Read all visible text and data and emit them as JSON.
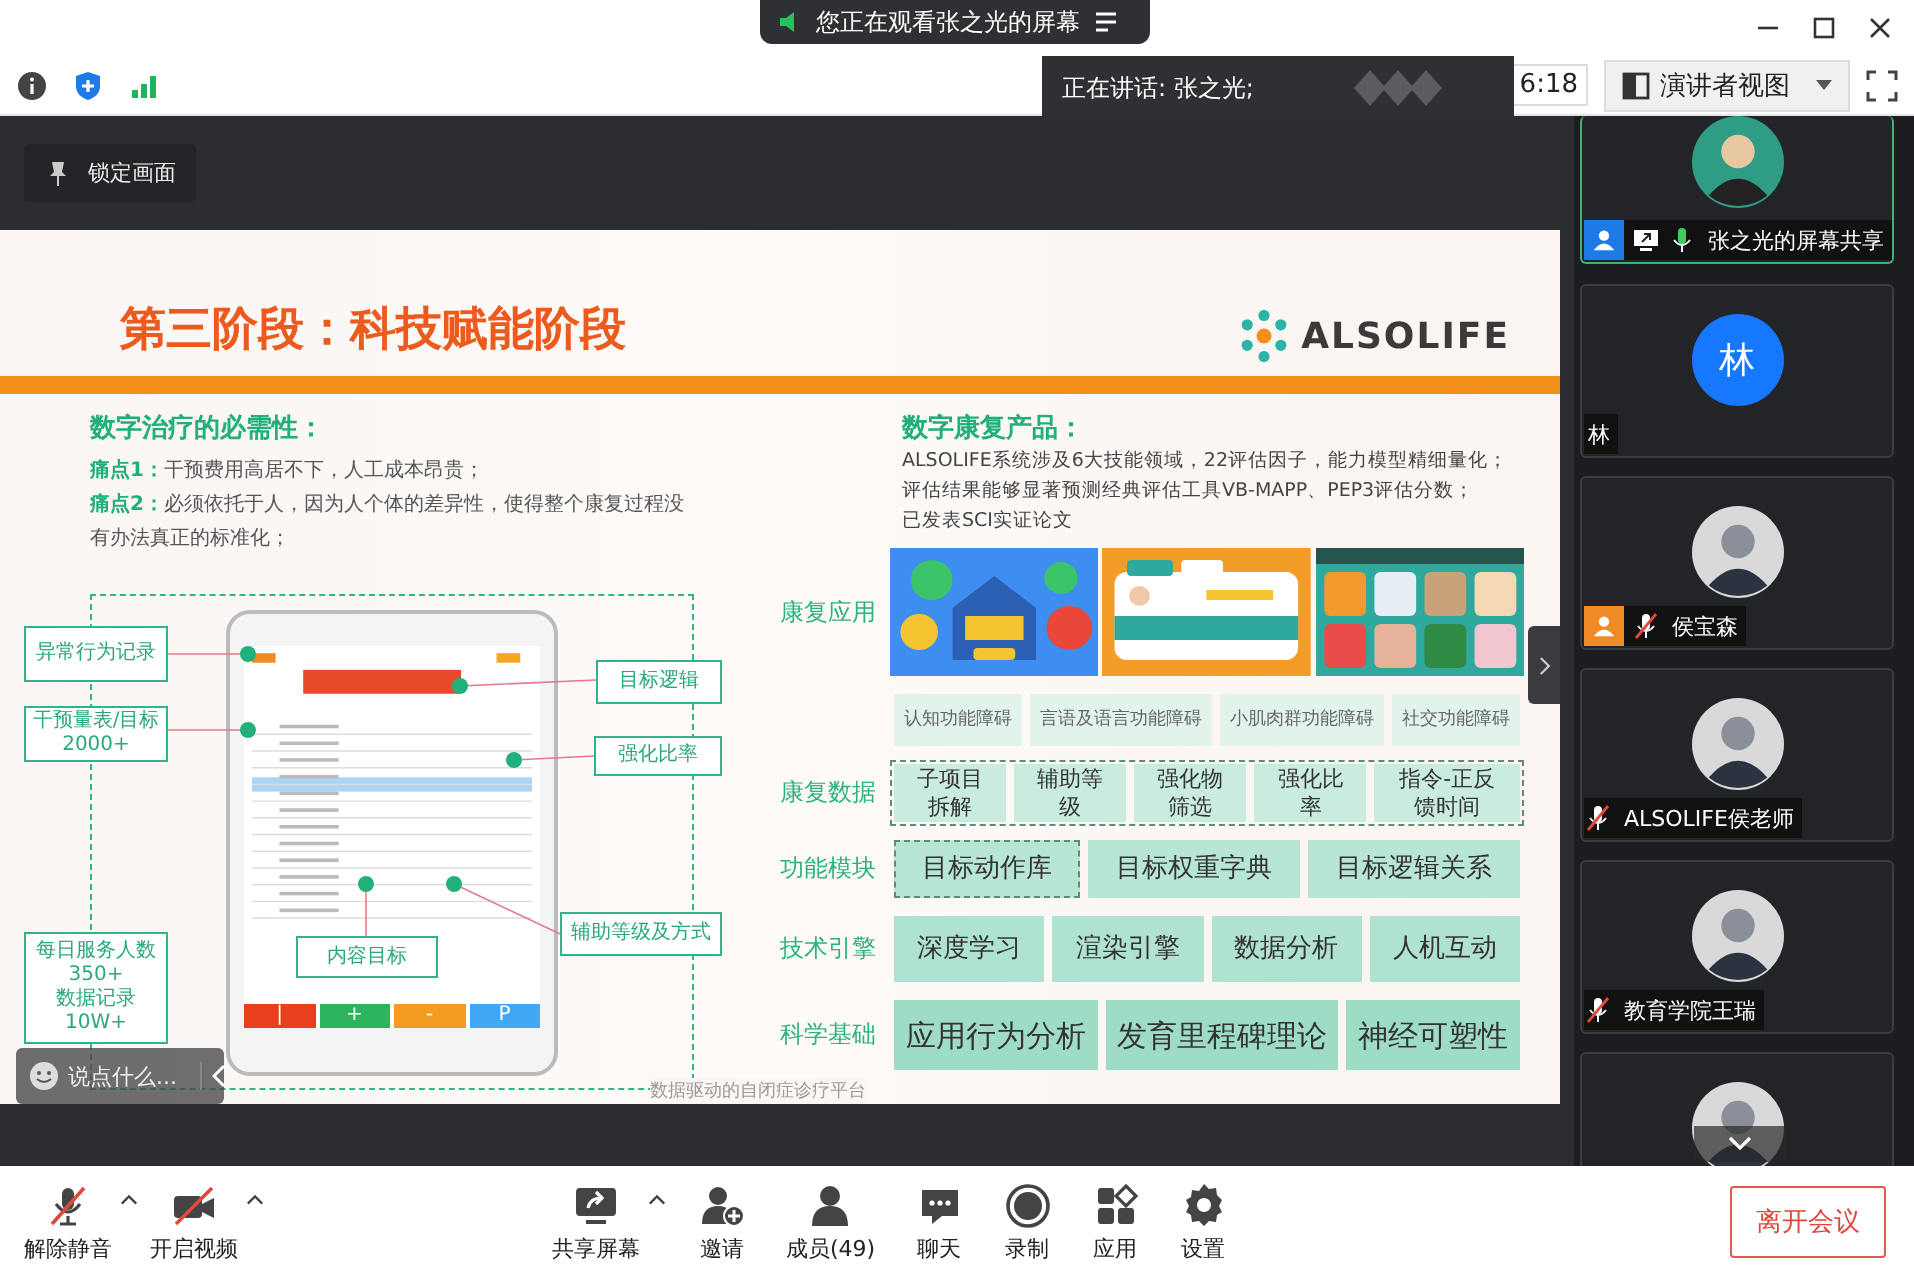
{
  "window": {
    "banner": "您正在观看张之光的屏幕",
    "controls": [
      {
        "kind": "minimize"
      },
      {
        "kind": "maximize"
      },
      {
        "kind": "close"
      }
    ]
  },
  "toolbar": {
    "status_icons": [
      {
        "kind": "info"
      },
      {
        "kind": "shield"
      },
      {
        "kind": "signal"
      }
    ],
    "time": "6:18",
    "view_mode": "演讲者视图"
  },
  "speaking": "正在讲话: 张之光;",
  "lock_button": "锁定画面",
  "slide": {
    "title": "第三阶段：科技赋能阶段",
    "logo": "ALSOLIFE",
    "left": {
      "heading": "数字治疗的必需性：",
      "points": [
        {
          "label": "痛点1：",
          "text": "干预费用高居不下，人工成本昂贵；"
        },
        {
          "label": "痛点2：",
          "text": "必须依托于人，因为人个体的差异性，使得整个康复过程没有办法真正的标准化；"
        }
      ]
    },
    "callouts": [
      {
        "text": "异常行为记录"
      },
      {
        "text": "干预量表/目标\n2000+"
      },
      {
        "text": "每日服务人数\n350+\n数据记录\n10W+"
      },
      {
        "text": "目标逻辑"
      },
      {
        "text": "强化比率"
      },
      {
        "text": "辅助等级及方式"
      },
      {
        "text": "内容目标"
      }
    ],
    "tablet_keys": [
      {
        "label": "|",
        "color": "#e8401c"
      },
      {
        "label": "+",
        "color": "#2db55d"
      },
      {
        "label": "-",
        "color": "#f39c1f"
      },
      {
        "label": "P",
        "color": "#3fa9f5"
      }
    ],
    "product": {
      "heading": "数字康复产品：",
      "lines": [
        "ALSOLIFE系统涉及6大技能领域，22评估因子，能力模型精细量化；",
        "评估结果能够显著预测经典评估工具VB-MAPP、PEP3评估分数；",
        "已发表SCI实证论文"
      ]
    },
    "layers": [
      {
        "label": "康复应用",
        "pictures": [
          {
            "kind": "picture"
          },
          {
            "kind": "picture"
          },
          {
            "kind": "picture"
          }
        ],
        "modules": [
          {
            "text": "认知功能障碍"
          },
          {
            "text": "言语及语言功能障碍"
          },
          {
            "text": "小肌肉群功能障碍"
          },
          {
            "text": "社交功能障碍"
          }
        ]
      },
      {
        "label": "康复数据",
        "outlined": true,
        "modules": [
          {
            "text": "子项目拆解"
          },
          {
            "text": "辅助等级"
          },
          {
            "text": "强化物筛选"
          },
          {
            "text": "强化比率"
          },
          {
            "text": "指令-正反馈时间"
          }
        ]
      },
      {
        "label": "功能模块",
        "modules": [
          {
            "text": "目标动作库",
            "outlined": true
          },
          {
            "text": "目标权重字典"
          },
          {
            "text": "目标逻辑关系"
          }
        ]
      },
      {
        "label": "技术引擎",
        "modules": [
          {
            "text": "深度学习"
          },
          {
            "text": "渲染引擎"
          },
          {
            "text": "数据分析"
          },
          {
            "text": "人机互动"
          }
        ]
      },
      {
        "label": "科学基础",
        "modules": [
          {
            "text": "应用行为分析"
          },
          {
            "text": "发育里程碑理论"
          },
          {
            "text": "神经可塑性"
          }
        ]
      }
    ],
    "footer": "数据驱动的自闭症诊疗平台"
  },
  "chat": {
    "placeholder": "说点什么..."
  },
  "participants": [
    {
      "name": "张之光的屏幕共享",
      "active": true,
      "badge": {
        "color": "#1e7be6"
      },
      "sharing": true,
      "mic_icon": true,
      "muted": false
    },
    {
      "name": "林",
      "initial": "林",
      "active": false,
      "mic_icon": false
    },
    {
      "name": "侯宝森",
      "active": false,
      "badge": {
        "color": "#f08a24"
      },
      "mic_icon": true,
      "muted": true
    },
    {
      "name": "ALSOLIFE侯老师",
      "active": false,
      "mic_icon": true,
      "muted": true
    },
    {
      "name": "教育学院王瑞",
      "active": false,
      "mic_icon": true,
      "muted": true
    },
    {
      "active": false
    }
  ],
  "bottom": {
    "left": [
      {
        "label": "解除静音",
        "kind": "mic-muted",
        "menu": true
      },
      {
        "label": "开启视频",
        "kind": "video-off",
        "menu": true
      }
    ],
    "center": [
      {
        "label": "共享屏幕",
        "kind": "share",
        "menu": true
      },
      {
        "label": "邀请",
        "kind": "invite"
      },
      {
        "label": "成员(49)",
        "kind": "members"
      },
      {
        "label": "聊天",
        "kind": "chat"
      },
      {
        "label": "录制",
        "kind": "record"
      },
      {
        "label": "应用",
        "kind": "apps"
      },
      {
        "label": "设置",
        "kind": "settings"
      }
    ],
    "leave": "离开会议"
  }
}
